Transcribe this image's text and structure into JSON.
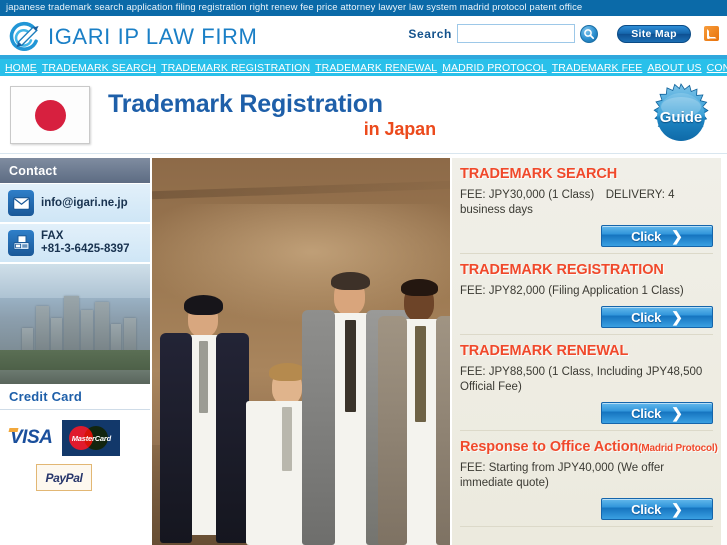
{
  "keyword_bar": {
    "text": "japanese trademark search application filing registration right renew fee price attorney lawyer law system madrid protocol patent office"
  },
  "masthead": {
    "brand": "IGARI IP LAW FIRM",
    "brand_icon": "pen-circle-logo-icon",
    "search_label": "Search",
    "search_value": "",
    "search_placeholder": "",
    "search_icon": "magnifier-icon",
    "sitemap_label": "Site Map",
    "rss_icon": "rss-feed-icon",
    "accent_blue": "#1a7fc6",
    "rule_color": "#2fa8dd"
  },
  "nav": {
    "background": "#29c0ea",
    "items": [
      {
        "label": "HOME"
      },
      {
        "label": "TRADEMARK SEARCH"
      },
      {
        "label": "TRADEMARK REGISTRATION"
      },
      {
        "label": "TRADEMARK RENEWAL"
      },
      {
        "label": "MADRID PROTOCOL"
      },
      {
        "label": "TRADEMARK FEE"
      },
      {
        "label": "ABOUT US"
      },
      {
        "label": "CONTACT"
      }
    ]
  },
  "banner": {
    "flag_icon": "japan-flag-icon",
    "title": "Trademark Registration",
    "subtitle": "in Japan",
    "title_color": "#1e5fa9",
    "subtitle_color": "#ec4a1c",
    "guide_label": "Guide",
    "guide_icon": "starburst-badge-icon"
  },
  "sidebar": {
    "contact_heading": "Contact",
    "contact_items": [
      {
        "icon": "envelope-icon",
        "label": "info@igari.ne.jp"
      },
      {
        "icon": "fax-machine-icon",
        "label": "FAX\n+81-3-6425-8397"
      }
    ],
    "city_photo_alt": "tokyo-skyline-photo",
    "credit_heading": "Credit Card",
    "cards": [
      {
        "name": "VISA",
        "icon": "visa-logo-icon"
      },
      {
        "name": "MasterCard",
        "icon": "mastercard-logo-icon"
      },
      {
        "name": "PayPal",
        "icon": "paypal-logo-icon"
      }
    ]
  },
  "hero": {
    "alt": "businessmen-running-photo"
  },
  "services": {
    "items": [
      {
        "title": "TRADEMARK SEARCH",
        "title_suffix": "",
        "fee": "FEE: JPY30,000 (1 Class)　DELIVERY: 4 business days",
        "button": "Click",
        "chevron": "❯"
      },
      {
        "title": "TRADEMARK REGISTRATION",
        "title_suffix": "",
        "fee": "FEE: JPY82,000 (Filing Application 1 Class)",
        "button": "Click",
        "chevron": "❯"
      },
      {
        "title": "TRADEMARK RENEWAL",
        "title_suffix": "",
        "fee": "FEE: JPY88,500 (1 Class, Including JPY48,500 Official Fee)",
        "button": "Click",
        "chevron": "❯"
      },
      {
        "title": "Response to Office Action",
        "title_suffix": "(Madrid Protocol)",
        "fee": "FEE: Starting from JPY40,000 (We offer immediate quote)",
        "button": "Click",
        "chevron": "❯"
      }
    ],
    "title_color": "#f0492b"
  }
}
